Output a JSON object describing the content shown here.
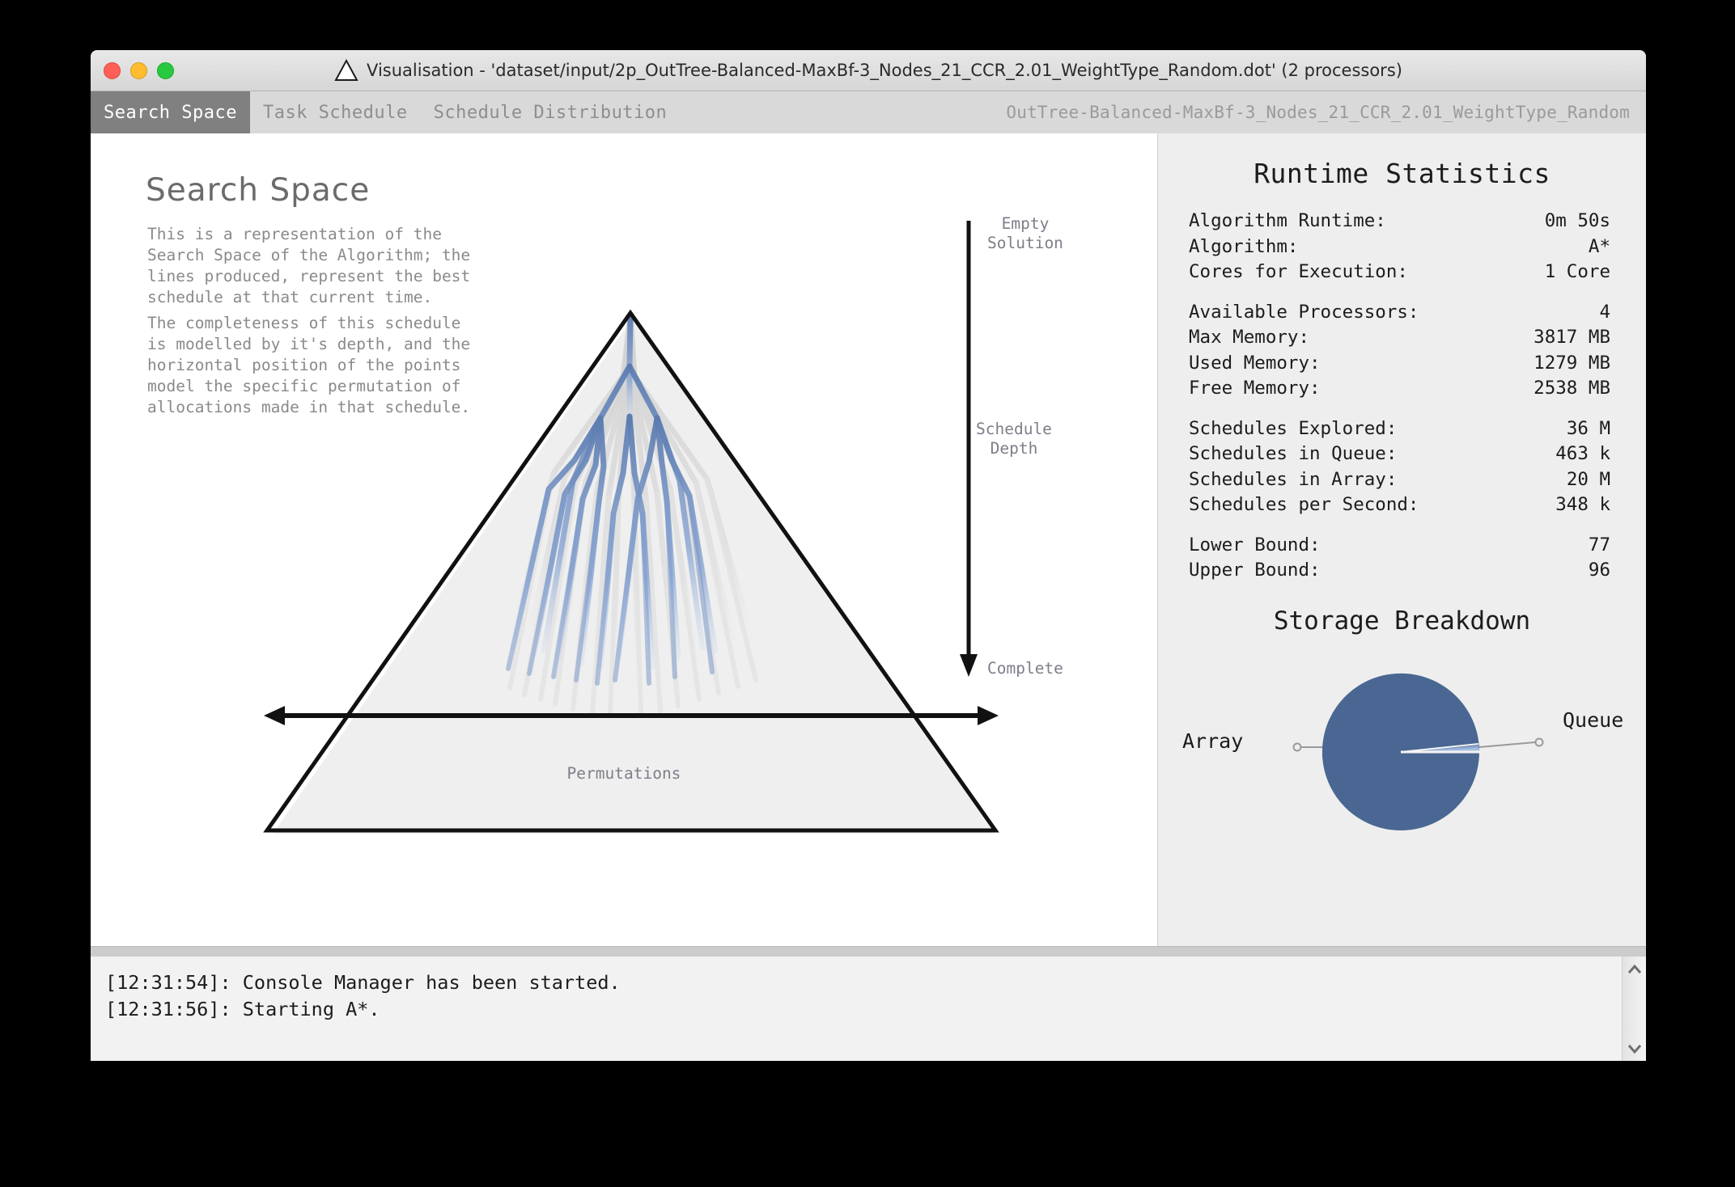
{
  "window": {
    "title": "Visualisation - 'dataset/input/2p_OutTree-Balanced-MaxBf-3_Nodes_21_CCR_2.01_WeightType_Random.dot' (2 processors)",
    "app_icon": "triangle-icon"
  },
  "tabs": [
    {
      "label": "Search Space",
      "active": true
    },
    {
      "label": "Task Schedule",
      "active": false
    },
    {
      "label": "Schedule Distribution",
      "active": false
    }
  ],
  "graph_name": "OutTree-Balanced-MaxBf-3_Nodes_21_CCR_2.01_WeightType_Random",
  "search_space": {
    "heading": "Search Space",
    "paragraph_1": "This is a representation of the Search Space of the Algorithm; the lines produced, represent the best schedule at that current time.",
    "paragraph_2": "The completeness of this schedule is modelled by it's depth, and the horizontal position of the points model the specific permutation of allocations made in that schedule.",
    "axis_top": "Empty\nSolution",
    "axis_middle": "Schedule\nDepth",
    "axis_bottom": "Complete",
    "axis_horizontal": "Permutations"
  },
  "runtime_statistics": {
    "title": "Runtime Statistics",
    "groups": [
      [
        {
          "label": "Algorithm Runtime:",
          "value": "0m 50s"
        },
        {
          "label": "Algorithm:",
          "value": "A*"
        },
        {
          "label": "Cores for Execution:",
          "value": "1 Core"
        }
      ],
      [
        {
          "label": "Available Processors:",
          "value": "4"
        },
        {
          "label": "Max Memory:",
          "value": "3817 MB"
        },
        {
          "label": "Used Memory:",
          "value": "1279 MB"
        },
        {
          "label": "Free Memory:",
          "value": "2538 MB"
        }
      ],
      [
        {
          "label": "Schedules Explored:",
          "value": "36 M"
        },
        {
          "label": "Schedules in Queue:",
          "value": "463 k"
        },
        {
          "label": "Schedules in Array:",
          "value": "20 M"
        },
        {
          "label": "Schedules per Second:",
          "value": "348 k"
        }
      ],
      [
        {
          "label": "Lower Bound:",
          "value": "77"
        },
        {
          "label": "Upper Bound:",
          "value": "96"
        }
      ]
    ]
  },
  "storage_breakdown": {
    "title": "Storage Breakdown",
    "label_array": "Array",
    "label_queue": "Queue"
  },
  "chart_data": {
    "type": "pie",
    "title": "Storage Breakdown",
    "categories": [
      "Array",
      "Queue"
    ],
    "values": [
      97.7,
      2.3
    ],
    "colors": [
      "#4a6793",
      "#8fa9d4"
    ],
    "legend": "callout-labels",
    "start_angle_deg": 0,
    "direction": "counterclockwise"
  },
  "console": {
    "lines": [
      "[12:31:54]: Console Manager has been started.",
      "[12:31:56]: Starting A*."
    ],
    "scroll_up_icon": "chevron-up-icon",
    "scroll_down_icon": "chevron-down-icon"
  },
  "colors": {
    "accent_blue": "#4a6793",
    "light_blue": "#8fa9d4",
    "active_tab_bg": "#808080",
    "panel_bg": "#eeeeee"
  }
}
